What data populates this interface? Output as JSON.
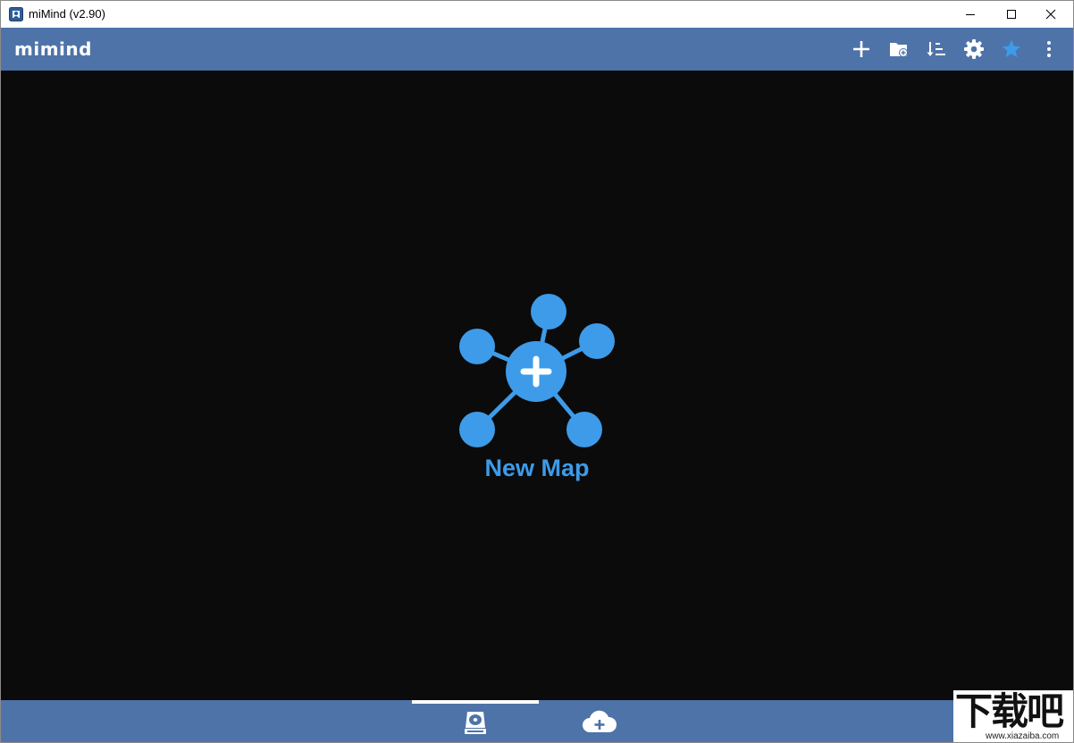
{
  "window": {
    "title": "miMind (v2.90)",
    "controls": [
      "minimize-icon",
      "maximize-icon",
      "close-icon"
    ]
  },
  "appbar": {
    "logo": "mimind",
    "background": "#4e73a8",
    "accent": "#3d9be9",
    "actions": [
      {
        "name": "add-icon"
      },
      {
        "name": "folder-add-icon"
      },
      {
        "name": "sort-icon"
      },
      {
        "name": "gear-icon"
      },
      {
        "name": "star-icon"
      },
      {
        "name": "more-vert-icon"
      }
    ]
  },
  "main": {
    "background": "#0b0b0b",
    "new_map": {
      "label": "New Map",
      "icon": "mind-map-add-icon"
    }
  },
  "bottombar": {
    "tabs": [
      {
        "name": "local-storage-icon",
        "selected": true
      },
      {
        "name": "cloud-add-icon",
        "selected": false
      }
    ]
  },
  "watermark": {
    "text": "下载吧",
    "url_text": "www.xiazaiba.com"
  }
}
